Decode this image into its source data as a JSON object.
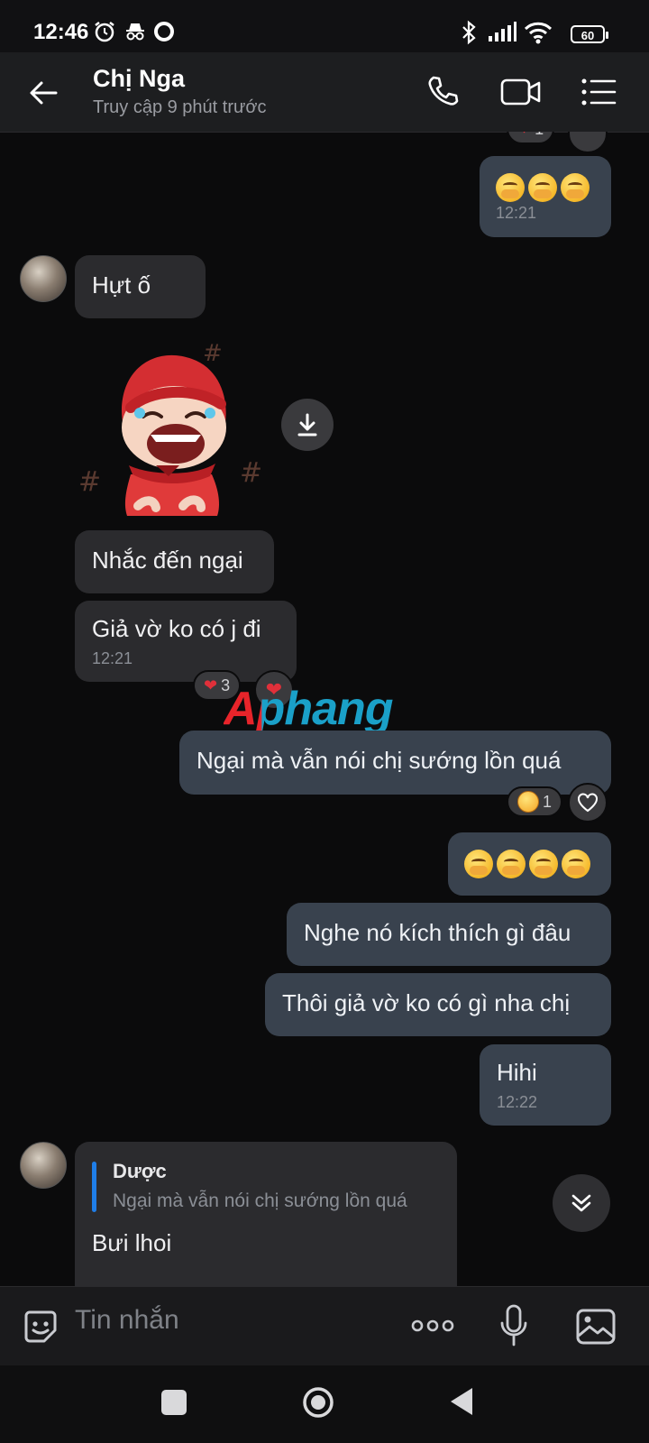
{
  "status_bar": {
    "time": "12:46",
    "battery": "60",
    "icons": [
      "alarm-icon",
      "incognito-icon",
      "circle-icon",
      "bluetooth-icon",
      "signal-icon",
      "wifi-icon",
      "battery-icon"
    ]
  },
  "header": {
    "name": "Chị Nga",
    "status": "Truy cập 9 phút trước",
    "icons": [
      "back-arrow-icon",
      "phone-icon",
      "video-call-icon",
      "menu-icon"
    ]
  },
  "messages": {
    "m1": {
      "time": "12:21"
    },
    "m2": {
      "text": "Hựt ố"
    },
    "m3": {
      "text": "Nhắc đến ngại"
    },
    "m4": {
      "text": "Giả vờ ko có j đi",
      "time": "12:21",
      "reaction_count": "3"
    },
    "m5": {
      "text": "Ngại mà vẫn nói chị sướng lồn quá",
      "reaction_count": "1"
    },
    "m7": {
      "text": "Nghe nó kích thích gì đâu"
    },
    "m8": {
      "text": "Thôi giả vờ ko có gì nha chị"
    },
    "m9": {
      "text": "Hihi",
      "time": "12:22"
    },
    "top_reaction_count": "1",
    "reply": {
      "author": "Dược",
      "quote": "Ngại mà vẫn nói chị sướng lồn quá",
      "text": "Bưi lhoi"
    }
  },
  "watermark": {
    "text": "Aphang",
    "color_a": "#e8242a",
    "color_b": "#1aa0c8"
  },
  "composer": {
    "placeholder": "Tin nhắn",
    "icons": [
      "sticker-icon",
      "more-icon",
      "microphone-icon",
      "image-icon"
    ]
  },
  "nav": {
    "icons": [
      "recents-icon",
      "home-icon",
      "back-icon"
    ]
  },
  "colors": {
    "incoming": "#2b2b2e",
    "outgoing": "#39424e",
    "accent": "#1f7ee8",
    "background": "#0b0b0c"
  }
}
